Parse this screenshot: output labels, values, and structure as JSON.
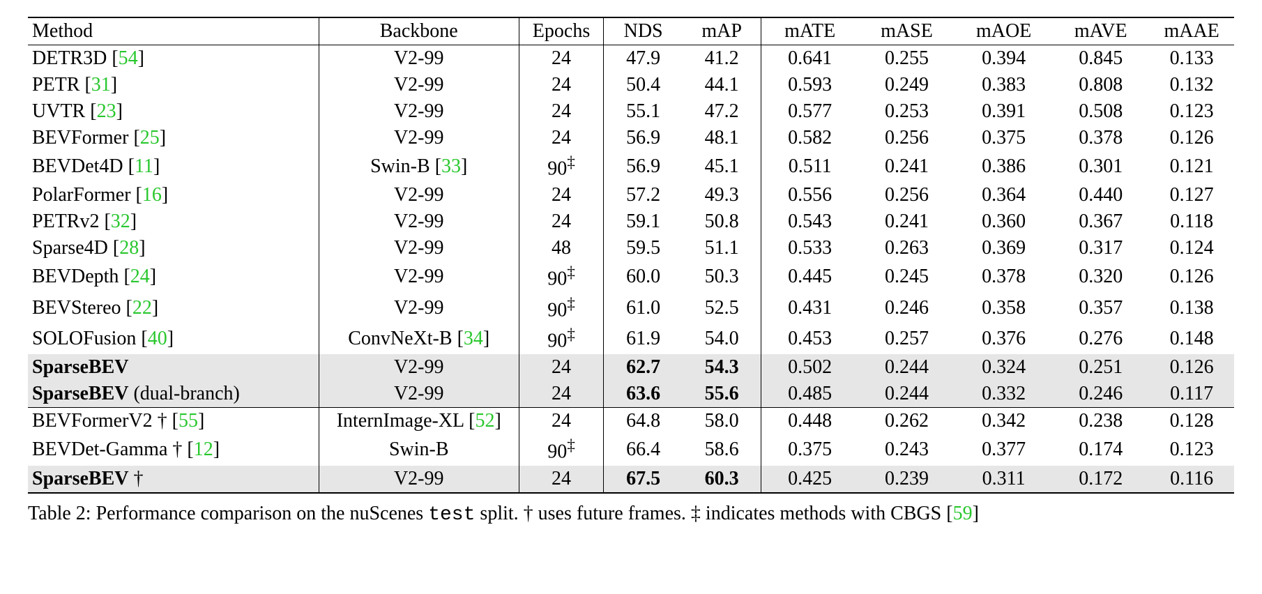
{
  "chart_data": {
    "type": "table",
    "title": "Performance comparison on the nuScenes test split",
    "columns": [
      "Method",
      "Backbone",
      "Epochs",
      "NDS",
      "mAP",
      "mATE",
      "mASE",
      "mAOE",
      "mAVE",
      "mAAE"
    ],
    "rows": [
      {
        "method": "DETR3D",
        "cite": "54",
        "backbone": "V2-99",
        "epochs": "24",
        "nds": "47.9",
        "map": "41.2",
        "mate": "0.641",
        "mase": "0.255",
        "maoe": "0.394",
        "mave": "0.845",
        "maae": "0.133"
      },
      {
        "method": "PETR",
        "cite": "31",
        "backbone": "V2-99",
        "epochs": "24",
        "nds": "50.4",
        "map": "44.1",
        "mate": "0.593",
        "mase": "0.249",
        "maoe": "0.383",
        "mave": "0.808",
        "maae": "0.132"
      },
      {
        "method": "UVTR",
        "cite": "23",
        "backbone": "V2-99",
        "epochs": "24",
        "nds": "55.1",
        "map": "47.2",
        "mate": "0.577",
        "mase": "0.253",
        "maoe": "0.391",
        "mave": "0.508",
        "maae": "0.123"
      },
      {
        "method": "BEVFormer",
        "cite": "25",
        "backbone": "V2-99",
        "epochs": "24",
        "nds": "56.9",
        "map": "48.1",
        "mate": "0.582",
        "mase": "0.256",
        "maoe": "0.375",
        "mave": "0.378",
        "maae": "0.126"
      },
      {
        "method": "BEVDet4D",
        "cite": "11",
        "backbone": "Swin-B",
        "backbone_cite": "33",
        "epochs": "90‡",
        "nds": "56.9",
        "map": "45.1",
        "mate": "0.511",
        "mase": "0.241",
        "maoe": "0.386",
        "mave": "0.301",
        "maae": "0.121"
      },
      {
        "method": "PolarFormer",
        "cite": "16",
        "backbone": "V2-99",
        "epochs": "24",
        "nds": "57.2",
        "map": "49.3",
        "mate": "0.556",
        "mase": "0.256",
        "maoe": "0.364",
        "mave": "0.440",
        "maae": "0.127"
      },
      {
        "method": "PETRv2",
        "cite": "32",
        "backbone": "V2-99",
        "epochs": "24",
        "nds": "59.1",
        "map": "50.8",
        "mate": "0.543",
        "mase": "0.241",
        "maoe": "0.360",
        "mave": "0.367",
        "maae": "0.118"
      },
      {
        "method": "Sparse4D",
        "cite": "28",
        "backbone": "V2-99",
        "epochs": "48",
        "nds": "59.5",
        "map": "51.1",
        "mate": "0.533",
        "mase": "0.263",
        "maoe": "0.369",
        "mave": "0.317",
        "maae": "0.124"
      },
      {
        "method": "BEVDepth",
        "cite": "24",
        "backbone": "V2-99",
        "epochs": "90‡",
        "nds": "60.0",
        "map": "50.3",
        "mate": "0.445",
        "mase": "0.245",
        "maoe": "0.378",
        "mave": "0.320",
        "maae": "0.126"
      },
      {
        "method": "BEVStereo",
        "cite": "22",
        "backbone": "V2-99",
        "epochs": "90‡",
        "nds": "61.0",
        "map": "52.5",
        "mate": "0.431",
        "mase": "0.246",
        "maoe": "0.358",
        "mave": "0.357",
        "maae": "0.138"
      },
      {
        "method": "SOLOFusion",
        "cite": "40",
        "backbone": "ConvNeXt-B",
        "backbone_cite": "34",
        "epochs": "90‡",
        "nds": "61.9",
        "map": "54.0",
        "mate": "0.453",
        "mase": "0.257",
        "maoe": "0.376",
        "mave": "0.276",
        "maae": "0.148"
      },
      {
        "method": "SparseBEV",
        "bold": true,
        "highlight": true,
        "backbone": "V2-99",
        "epochs": "24",
        "nds": "62.7",
        "map": "54.3",
        "mate": "0.502",
        "mase": "0.244",
        "maoe": "0.324",
        "mave": "0.251",
        "maae": "0.126"
      },
      {
        "method": "SparseBEV",
        "method_suffix": " (dual-branch)",
        "bold": true,
        "highlight": true,
        "backbone": "V2-99",
        "epochs": "24",
        "nds": "63.6",
        "map": "55.6",
        "mate": "0.485",
        "mase": "0.244",
        "maoe": "0.332",
        "mave": "0.246",
        "maae": "0.117"
      }
    ],
    "rows2": [
      {
        "method": "BEVFormerV2 †",
        "cite": "55",
        "backbone": "InternImage-XL",
        "backbone_cite": "52",
        "epochs": "24",
        "nds": "64.8",
        "map": "58.0",
        "mate": "0.448",
        "mase": "0.262",
        "maoe": "0.342",
        "mave": "0.238",
        "maae": "0.128"
      },
      {
        "method": "BEVDet-Gamma †",
        "cite": "12",
        "backbone": "Swin-B",
        "epochs": "90‡",
        "nds": "66.4",
        "map": "58.6",
        "mate": "0.375",
        "mase": "0.243",
        "maoe": "0.377",
        "mave": "0.174",
        "maae": "0.123"
      },
      {
        "method": "SparseBEV",
        "method_dagger": " †",
        "bold": true,
        "highlight": true,
        "backbone": "V2-99",
        "epochs": "24",
        "nds": "67.5",
        "map": "60.3",
        "mate": "0.425",
        "mase": "0.239",
        "maoe": "0.311",
        "mave": "0.172",
        "maae": "0.116"
      }
    ]
  },
  "header": {
    "method": "Method",
    "backbone": "Backbone",
    "epochs": "Epochs",
    "nds": "NDS",
    "map": "mAP",
    "mate": "mATE",
    "mase": "mASE",
    "maoe": "mAOE",
    "mave": "mAVE",
    "maae": "mAAE"
  },
  "caption": {
    "prefix": "Table 2: Performance comparison on the nuScenes ",
    "tt": "test",
    "mid": " split. † uses future frames. ‡ indicates methods with CBGS [",
    "cite": "59",
    "suffix": "]"
  }
}
